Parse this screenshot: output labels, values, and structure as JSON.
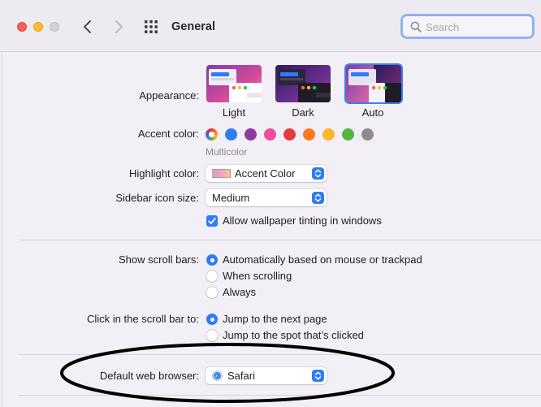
{
  "window": {
    "title": "General"
  },
  "search": {
    "placeholder": "Search",
    "value": ""
  },
  "appearance": {
    "label": "Appearance:",
    "options": [
      {
        "label": "Light",
        "selected": false
      },
      {
        "label": "Dark",
        "selected": false
      },
      {
        "label": "Auto",
        "selected": true
      }
    ]
  },
  "accent": {
    "label": "Accent color:",
    "selected_name": "Multicolor",
    "colors": [
      "multicolor",
      "#2f7cf6",
      "#8e3a9c",
      "#ee4c9c",
      "#e53a3f",
      "#f77b1e",
      "#fbb72c",
      "#55b543",
      "#8e8c8f"
    ]
  },
  "highlight": {
    "label": "Highlight color:",
    "value": "Accent Color"
  },
  "sidebar_icon_size": {
    "label": "Sidebar icon size:",
    "value": "Medium"
  },
  "wallpaper_tinting": {
    "label": "Allow wallpaper tinting in windows",
    "checked": true
  },
  "scroll_bars": {
    "label": "Show scroll bars:",
    "options": [
      {
        "label": "Automatically based on mouse or trackpad",
        "selected": true
      },
      {
        "label": "When scrolling",
        "selected": false
      },
      {
        "label": "Always",
        "selected": false
      }
    ]
  },
  "click_scroll_bar": {
    "label": "Click in the scroll bar to:",
    "options": [
      {
        "label": "Jump to the next page",
        "selected": true
      },
      {
        "label": "Jump to the spot that’s clicked",
        "selected": false
      }
    ]
  },
  "default_browser": {
    "label": "Default web browser:",
    "value": "Safari"
  },
  "colors": {
    "accent": "#2f7cf6",
    "annotation": "#000000"
  }
}
